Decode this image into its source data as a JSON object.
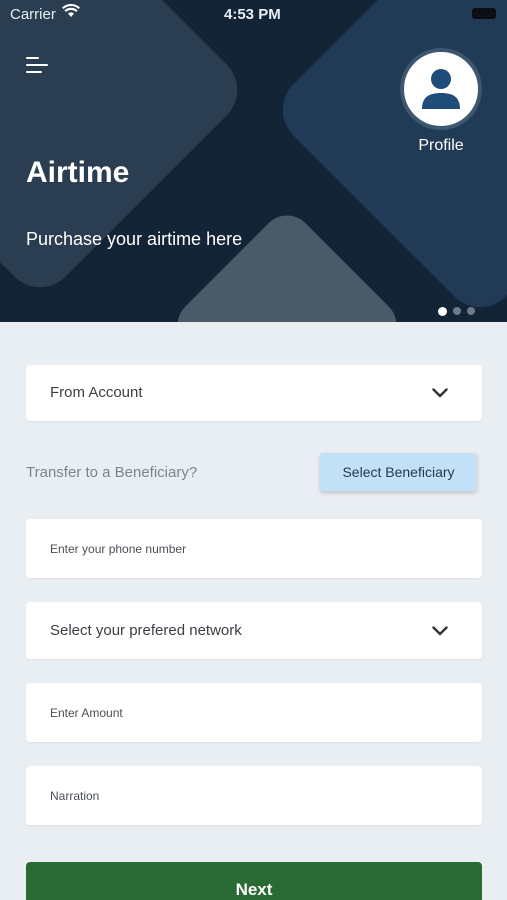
{
  "status_bar": {
    "carrier": "Carrier",
    "time": "4:53 PM"
  },
  "header": {
    "title": "Airtime",
    "subtitle": "Purchase your airtime here",
    "profile_label": "Profile",
    "carousel": {
      "count": 3,
      "active_index": 0
    }
  },
  "form": {
    "from_account": "From Account",
    "transfer_prompt": "Transfer to a Beneficiary?",
    "select_beneficiary": "Select Beneficiary",
    "phone_placeholder": "Enter your phone number",
    "network": "Select your prefered network",
    "amount_placeholder": "Enter Amount",
    "narration_placeholder": "Narration",
    "next": "Next"
  },
  "colors": {
    "header_bg": "#142437",
    "page_bg": "#e9eef3",
    "beneficiary_button": "#c2e1f7",
    "next_button": "#2a6b35",
    "avatar_fg": "#1f4d7a"
  },
  "icons": [
    "wifi-icon",
    "battery-icon",
    "menu-icon",
    "user-icon",
    "chevron-down-icon"
  ]
}
